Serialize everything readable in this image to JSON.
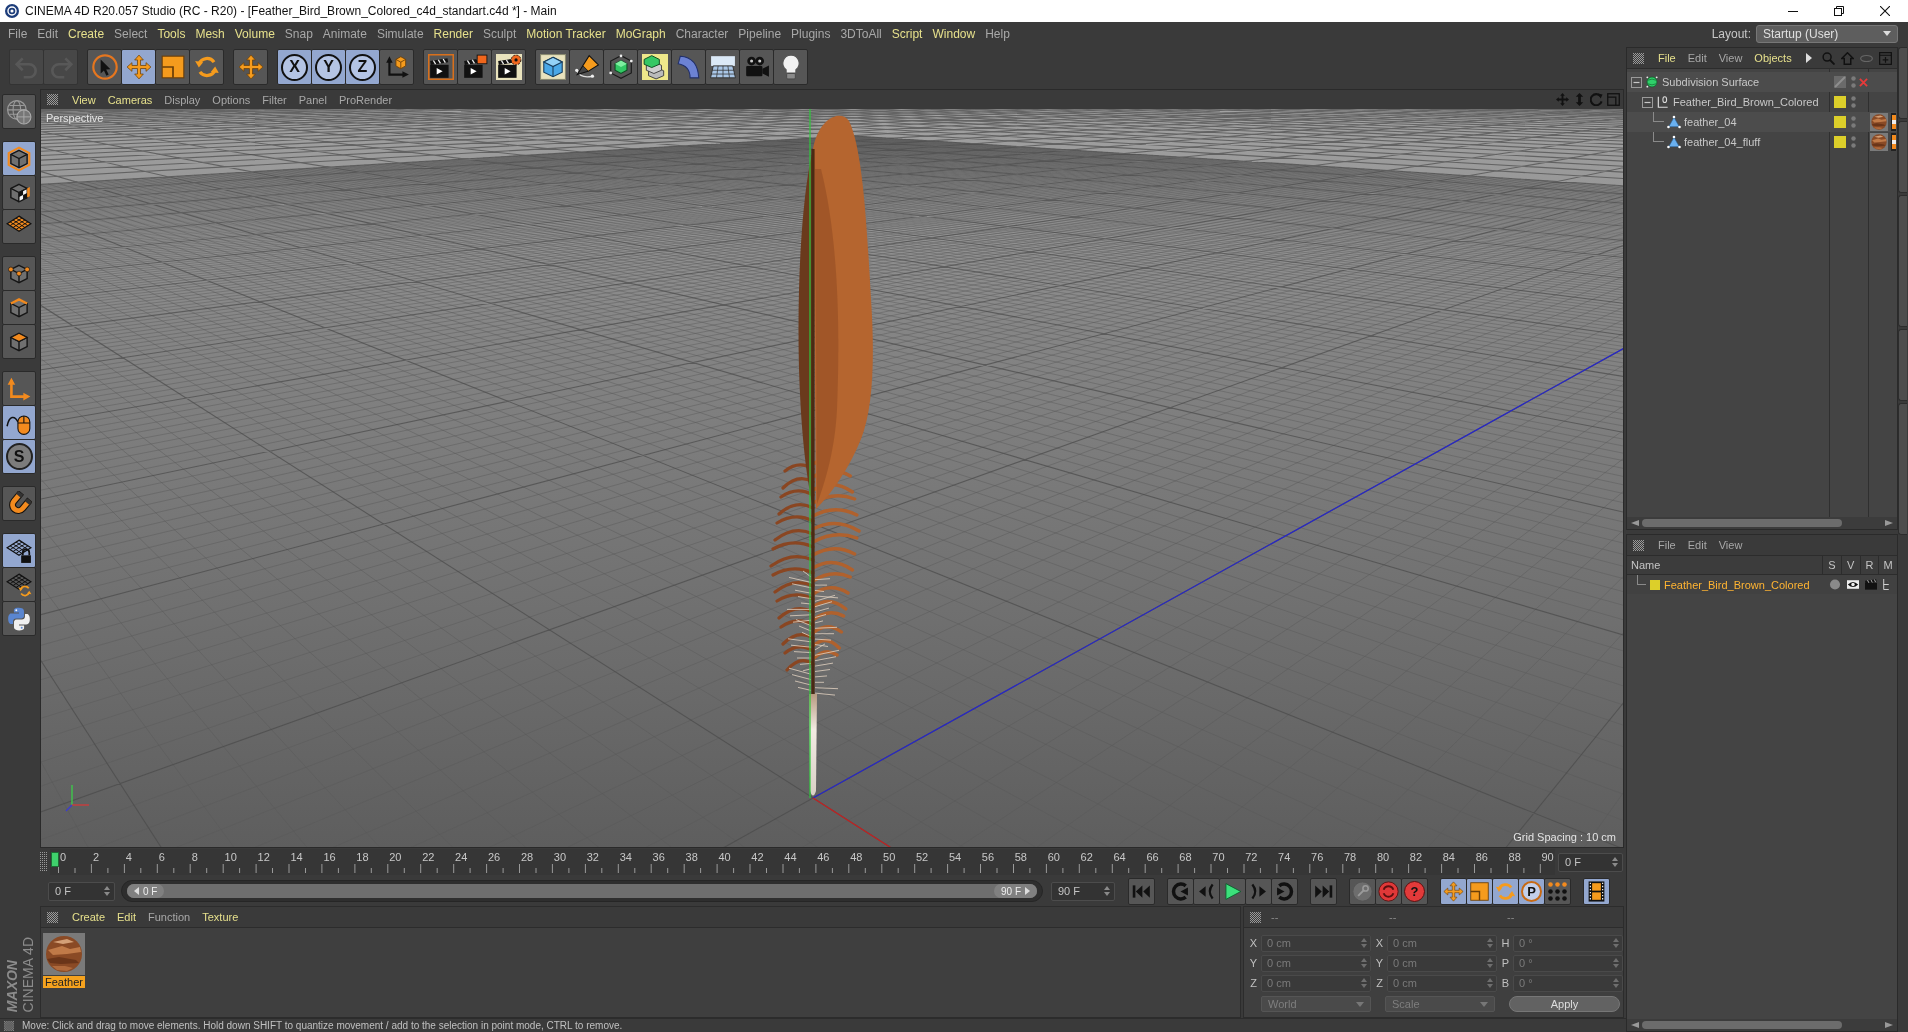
{
  "window": {
    "title": "CINEMA 4D R20.057 Studio (RC - R20) - [Feather_Bird_Brown_Colored_c4d_standart.c4d *] - Main"
  },
  "menu_bar": {
    "items": [
      {
        "label": "File",
        "highlighted": false
      },
      {
        "label": "Edit",
        "highlighted": false
      },
      {
        "label": "Create",
        "highlighted": true
      },
      {
        "label": "Select",
        "highlighted": false
      },
      {
        "label": "Tools",
        "highlighted": true
      },
      {
        "label": "Mesh",
        "highlighted": true
      },
      {
        "label": "Volume",
        "highlighted": true
      },
      {
        "label": "Snap",
        "highlighted": false
      },
      {
        "label": "Animate",
        "highlighted": false
      },
      {
        "label": "Simulate",
        "highlighted": false
      },
      {
        "label": "Render",
        "highlighted": true
      },
      {
        "label": "Sculpt",
        "highlighted": false
      },
      {
        "label": "Motion Tracker",
        "highlighted": true
      },
      {
        "label": "MoGraph",
        "highlighted": true
      },
      {
        "label": "Character",
        "highlighted": false
      },
      {
        "label": "Pipeline",
        "highlighted": false
      },
      {
        "label": "Plugins",
        "highlighted": false
      },
      {
        "label": "3DToAll",
        "highlighted": false
      },
      {
        "label": "Script",
        "highlighted": true
      },
      {
        "label": "Window",
        "highlighted": true
      },
      {
        "label": "Help",
        "highlighted": false
      }
    ],
    "layout_label": "Layout:",
    "layout_value": "Startup (User)"
  },
  "toolbar": {
    "groups": [
      {
        "tools": [
          {
            "kind": "undo",
            "selected": false,
            "disabled": true
          },
          {
            "kind": "redo",
            "selected": false,
            "disabled": true
          }
        ]
      },
      {
        "tools": [
          {
            "kind": "select",
            "selected": false,
            "disabled": false
          },
          {
            "kind": "move",
            "selected": true,
            "disabled": false
          },
          {
            "kind": "scale",
            "selected": false,
            "disabled": false
          },
          {
            "kind": "rotate",
            "selected": false,
            "disabled": false
          }
        ]
      },
      {
        "tools": [
          {
            "kind": "move",
            "selected": false,
            "disabled": false
          }
        ]
      },
      {
        "tools": [
          {
            "kind": "axis-lock",
            "label": "X",
            "selected": true,
            "disabled": false
          },
          {
            "kind": "axis-lock",
            "label": "Y",
            "selected": true,
            "disabled": false
          },
          {
            "kind": "axis-lock",
            "label": "Z",
            "selected": true,
            "disabled": false
          },
          {
            "kind": "coordinate-system",
            "selected": false,
            "disabled": false
          }
        ]
      },
      {
        "tools": [
          {
            "kind": "render-view",
            "selected": false,
            "disabled": false
          },
          {
            "kind": "render-viewer",
            "selected": false,
            "disabled": false
          },
          {
            "kind": "render-settings",
            "selected": false,
            "disabled": false
          }
        ]
      },
      {
        "tools": [
          {
            "kind": "cube",
            "selected": false,
            "disabled": false
          },
          {
            "kind": "pen",
            "selected": false,
            "disabled": false
          },
          {
            "kind": "subdivision",
            "selected": false,
            "disabled": false
          },
          {
            "kind": "cloner",
            "selected": false,
            "disabled": false
          },
          {
            "kind": "deformer",
            "selected": false,
            "disabled": false
          },
          {
            "kind": "floor",
            "selected": false,
            "disabled": false
          },
          {
            "kind": "camera",
            "selected": false,
            "disabled": false
          },
          {
            "kind": "light",
            "selected": false,
            "disabled": false
          }
        ]
      }
    ]
  },
  "mode_toolbar": {
    "groups": [
      {
        "tools": [
          {
            "kind": "make-editable",
            "selected": false
          }
        ]
      },
      {
        "tools": [
          {
            "kind": "model",
            "selected": true
          },
          {
            "kind": "texture",
            "selected": false
          },
          {
            "kind": "workplane",
            "selected": false
          }
        ]
      },
      {
        "tools": [
          {
            "kind": "points",
            "selected": false
          },
          {
            "kind": "edges",
            "selected": false
          },
          {
            "kind": "polygons",
            "selected": false
          }
        ]
      },
      {
        "tools": [
          {
            "kind": "axis",
            "selected": false
          },
          {
            "kind": "tweak",
            "selected": true
          },
          {
            "kind": "solo",
            "label": "S",
            "selected": true
          }
        ]
      },
      {
        "tools": [
          {
            "kind": "snap",
            "selected": false
          }
        ]
      },
      {
        "tools": [
          {
            "kind": "grid-lock",
            "selected": true
          },
          {
            "kind": "grid-rotate",
            "selected": false
          },
          {
            "kind": "python",
            "selected": false
          }
        ]
      }
    ]
  },
  "viewport": {
    "menu": [
      {
        "label": "View",
        "highlighted": true
      },
      {
        "label": "Cameras",
        "highlighted": true
      },
      {
        "label": "Display",
        "highlighted": false
      },
      {
        "label": "Options",
        "highlighted": false
      },
      {
        "label": "Filter",
        "highlighted": false
      },
      {
        "label": "Panel",
        "highlighted": false
      },
      {
        "label": "ProRender",
        "highlighted": false
      }
    ],
    "camera_label": "Perspective",
    "grid_spacing": "Grid Spacing : 10 cm"
  },
  "timeline": {
    "frames": [
      "0",
      "2",
      "4",
      "6",
      "8",
      "10",
      "12",
      "14",
      "16",
      "18",
      "20",
      "22",
      "24",
      "26",
      "28",
      "30",
      "32",
      "34",
      "36",
      "38",
      "40",
      "42",
      "44",
      "46",
      "48",
      "50",
      "52",
      "54",
      "56",
      "58",
      "60",
      "62",
      "64",
      "66",
      "68",
      "70",
      "72",
      "74",
      "76",
      "78",
      "80",
      "82",
      "84",
      "86",
      "88",
      "90"
    ],
    "level": 0,
    "current_frame": "0 F"
  },
  "transport": {
    "start_field": "0 F",
    "range_start": "0 F",
    "range_end": "90 F",
    "level": 1,
    "end_field": "90 F",
    "groups": [
      {
        "tools": [
          {
            "kind": "first-frame",
            "selected": false
          }
        ]
      },
      {
        "tools": [
          {
            "kind": "prev-key",
            "selected": false
          },
          {
            "kind": "prev-frame",
            "selected": false
          },
          {
            "kind": "play",
            "selected": false
          },
          {
            "kind": "next-frame",
            "selected": false
          },
          {
            "kind": "next-key",
            "selected": false
          }
        ]
      },
      {
        "tools": [
          {
            "kind": "last-frame",
            "selected": false
          }
        ]
      },
      {
        "tools": [
          {
            "kind": "record-off",
            "selected": false
          },
          {
            "kind": "autokey",
            "selected": false
          },
          {
            "kind": "key-selection",
            "label": "?",
            "selected": false
          }
        ]
      },
      {
        "tools": [
          {
            "kind": "move",
            "selected": true
          },
          {
            "kind": "scale",
            "selected": true
          },
          {
            "kind": "rotate",
            "selected": true
          },
          {
            "kind": "parameter-key",
            "label": "P",
            "selected": true
          },
          {
            "kind": "dots",
            "selected": false
          }
        ]
      },
      {
        "tools": [
          {
            "kind": "film",
            "selected": true
          }
        ]
      }
    ]
  },
  "material_manager": {
    "menu": [
      {
        "label": "Create",
        "highlighted": true
      },
      {
        "label": "Edit",
        "highlighted": true
      },
      {
        "label": "Function",
        "highlighted": false
      },
      {
        "label": "Texture",
        "highlighted": true
      }
    ],
    "materials": [
      {
        "name": "Feather",
        "selected": true
      }
    ]
  },
  "logo": {
    "brand": "MAXON",
    "product": "CINEMA 4D"
  },
  "coordinates": {
    "disabled": true,
    "headers": [
      "--",
      "--",
      "--"
    ],
    "columns": [
      {
        "rows": [
          {
            "label": "X",
            "value": "0 cm"
          },
          {
            "label": "Y",
            "value": "0 cm"
          },
          {
            "label": "Z",
            "value": "0 cm"
          }
        ]
      },
      {
        "rows": [
          {
            "label": "X",
            "value": "0 cm"
          },
          {
            "label": "Y",
            "value": "0 cm"
          },
          {
            "label": "Z",
            "value": "0 cm"
          }
        ]
      },
      {
        "rows": [
          {
            "label": "H",
            "value": "0 °"
          },
          {
            "label": "P",
            "value": "0 °"
          },
          {
            "label": "B",
            "value": "0 °"
          }
        ]
      }
    ],
    "space": "World",
    "mode": "Scale",
    "apply": "Apply"
  },
  "status_bar": {
    "text": "Move: Click and drag to move elements. Hold down SHIFT to quantize movement / add to the selection in point mode, CTRL to remove."
  },
  "object_manager": {
    "menu": [
      {
        "label": "File",
        "highlighted": true
      },
      {
        "label": "Edit",
        "highlighted": false
      },
      {
        "label": "View",
        "highlighted": false
      },
      {
        "label": "Objects",
        "highlighted": true
      }
    ],
    "tree": [
      {
        "name": "Subdivision Surface",
        "kind": "generator",
        "expanded": true,
        "enabled": false,
        "children": [
          {
            "name": "Feather_Bird_Brown_Colored",
            "kind": "null",
            "expanded": true,
            "color": "#dccf2a",
            "children": [
              {
                "name": "feather_04",
                "kind": "polygon",
                "color": "#dccf2a",
                "tags": [
                  {
                    "kind": "material"
                  },
                  {
                    "kind": "phong"
                  }
                ]
              },
              {
                "name": "feather_04_fluff",
                "kind": "polygon",
                "color": "#dccf2a",
                "tags": [
                  {
                    "kind": "material"
                  },
                  {
                    "kind": "phong"
                  }
                ]
              }
            ]
          }
        ]
      }
    ]
  },
  "layer_manager": {
    "menu": [
      {
        "label": "File",
        "highlighted": false
      },
      {
        "label": "Edit",
        "highlighted": false
      },
      {
        "label": "View",
        "highlighted": false
      }
    ],
    "columns": [
      "Name",
      "S",
      "V",
      "R",
      "M"
    ],
    "layers": [
      {
        "name": "Feather_Bird_Brown_Colored",
        "color": "#dccf2a",
        "selected": true
      }
    ]
  }
}
